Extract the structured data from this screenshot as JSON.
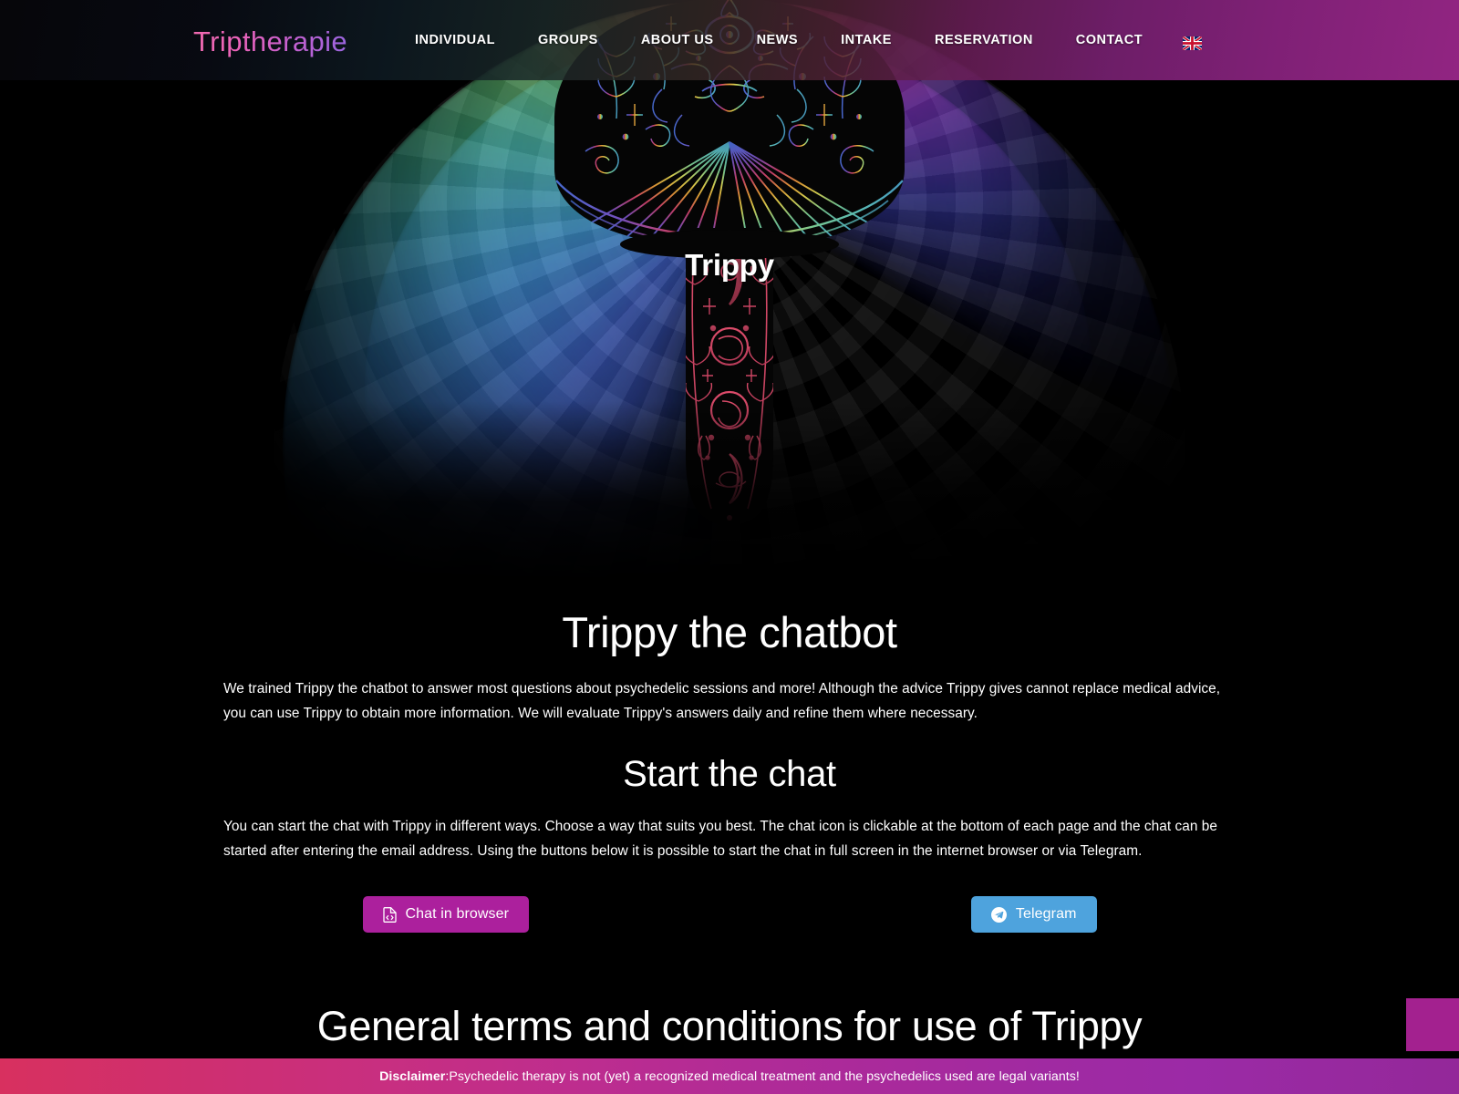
{
  "navbar": {
    "logo": "Triptherapie",
    "links": [
      {
        "label": "INDIVIDUAL",
        "name": "nav-link-individual"
      },
      {
        "label": "GROUPS",
        "name": "nav-link-groups"
      },
      {
        "label": "ABOUT US",
        "name": "nav-link-about-us"
      },
      {
        "label": "NEWS",
        "name": "nav-link-news"
      },
      {
        "label": "INTAKE",
        "name": "nav-link-intake"
      },
      {
        "label": "RESERVATION",
        "name": "nav-link-reservation"
      },
      {
        "label": "CONTACT",
        "name": "nav-link-contact"
      }
    ],
    "language_icon": "uk-flag-icon",
    "language_label": "English"
  },
  "hero": {
    "title": "Trippy",
    "art": "psychedelic-mushroom-illustration"
  },
  "main": {
    "heading_chatbot": "Trippy the chatbot",
    "paragraph_chatbot": "We trained Trippy the chatbot to answer most questions about psychedelic sessions and more! Although the advice Trippy gives cannot replace medical advice, you can use Trippy to obtain more information. We will evaluate Trippy's answers daily and refine them where necessary.",
    "heading_start_chat": "Start the chat",
    "paragraph_start_chat": "You can start the chat with Trippy in different ways. Choose a way that suits you best. The chat icon is clickable at the bottom of each page and the chat can be started after entering the email address. Using the buttons below it is possible to start the chat in full screen in the internet browser or via Telegram.",
    "button_browser": "Chat in browser",
    "button_browser_icon": "file-code-icon",
    "button_telegram": "Telegram",
    "button_telegram_icon": "telegram-paper-plane-icon",
    "heading_terms": "General terms and conditions for use of Trippy"
  },
  "chat_widget": {
    "icon": "chat-bubble-icon",
    "color": "#a3218f"
  },
  "disclaimer": {
    "label": "Disclaimer",
    "separator": ": ",
    "text": "Psychedelic therapy is not (yet) a recognized medical treatment and the psychedelics used are legal variants!"
  },
  "colors": {
    "background": "#000000",
    "accent_magenta": "#ac209d",
    "accent_blue": "#4ea3dd",
    "logo_pink": "#f06ab0",
    "logo_purple": "#9a66e0"
  }
}
